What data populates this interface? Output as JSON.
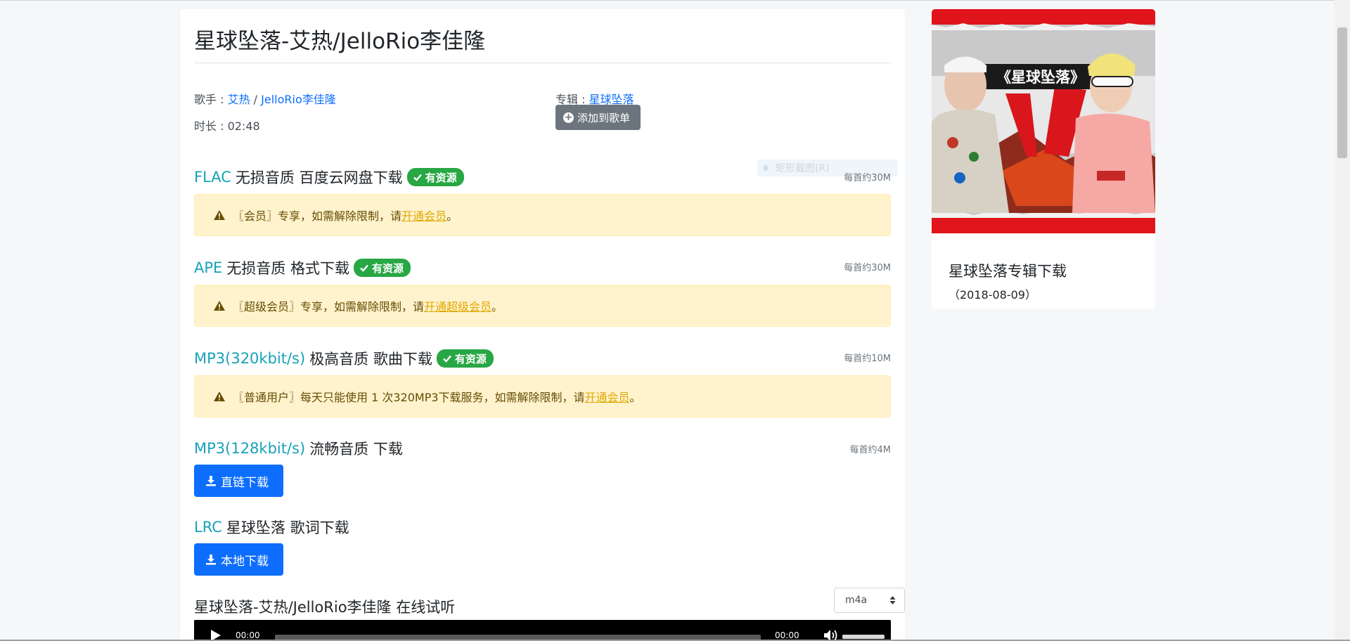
{
  "song": {
    "title": "星球坠落-艾热/JelloRio李佳隆",
    "singer_label": "歌手 : ",
    "singer1": "艾热",
    "singer_sep": " / ",
    "singer2": "JelloRio李佳隆",
    "album_label": "专辑 : ",
    "album": "星球坠落",
    "duration_text": "时长 : 02:48",
    "add_to_playlist": "添加到歌单"
  },
  "sections": {
    "flac": {
      "fmt": "FLAC",
      "desc": "无损音质 百度云网盘下载",
      "badge": "有资源",
      "size": "每首约30M",
      "alert_text": "〖会员〗专享，如需解除限制，请",
      "alert_link": "开通会员",
      "alert_end": "。"
    },
    "ape": {
      "fmt": "APE",
      "desc": "无损音质 格式下载",
      "badge": "有资源",
      "size": "每首约30M",
      "alert_text": "〖超级会员〗专享，如需解除限制，请",
      "alert_link": "开通超级会员",
      "alert_end": "。"
    },
    "mp3_320": {
      "fmt": "MP3(320kbit/s)",
      "desc": "极高音质 歌曲下载",
      "badge": "有资源",
      "size": "每首约10M",
      "alert_text": "〖普通用户〗每天只能使用 1 次320MP3下载服务，如需解除限制，请",
      "alert_link": "开通会员",
      "alert_end": "。"
    },
    "mp3_128": {
      "fmt": "MP3(128kbit/s)",
      "desc": "流畅音质 下载",
      "size": "每首约4M",
      "button": "直链下载"
    },
    "lrc": {
      "fmt": "LRC",
      "desc": "星球坠落 歌词下载",
      "button": "本地下载"
    }
  },
  "overlay_hint": "矩形截图(R)",
  "listen": {
    "title": "星球坠落-艾热/JelloRio李佳隆 在线试听",
    "format_selected": "m4a",
    "current_time": "00:00",
    "duration": "00:00"
  },
  "album_card": {
    "cover_caption": "《星球坠落》",
    "title": "星球坠落专辑下载",
    "date": "（2018-08-09）"
  },
  "colors": {
    "link": "#0d6efd",
    "format_teal": "#17a2b8",
    "badge_green": "#28a745",
    "alert_bg": "#fff3cd",
    "alert_link": "#e0a800",
    "button_blue": "#0d6efd",
    "button_grey": "#6c757d"
  },
  "icons": {
    "add": "plus-circle-icon",
    "badge": "check-icon",
    "alert": "warning-icon",
    "download": "download-icon",
    "select": "sort-arrows-icon",
    "play": "play-icon",
    "volume": "volume-icon"
  }
}
